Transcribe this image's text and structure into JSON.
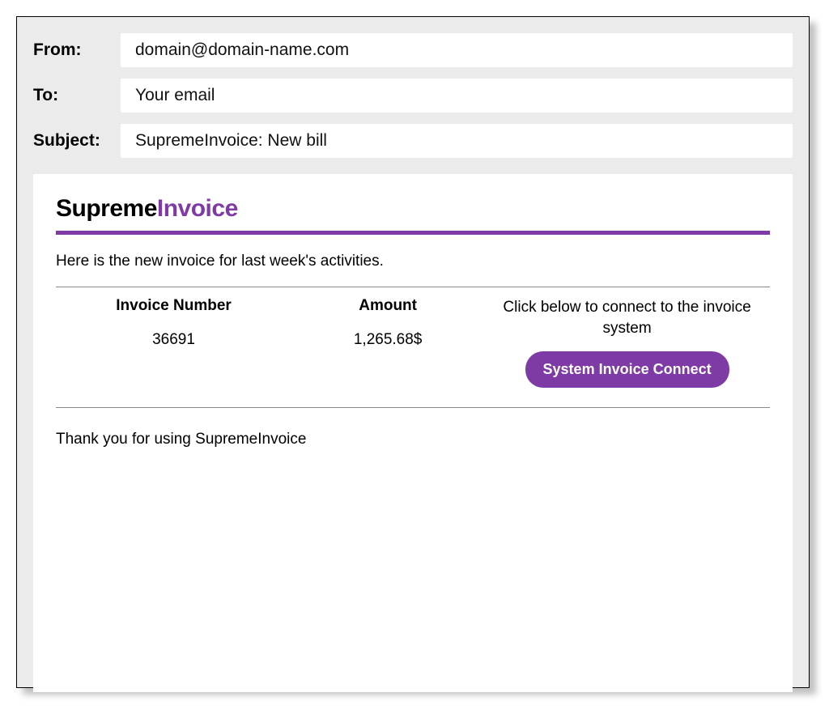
{
  "header": {
    "from_label": "From:",
    "from_value": "domain@domain-name.com",
    "to_label": "To:",
    "to_value": "Your email",
    "subject_label": "Subject:",
    "subject_value": "SupremeInvoice: New bill"
  },
  "body": {
    "brand_first": "Supreme",
    "brand_second": "Invoice",
    "intro": "Here is the new invoice for last week's activities.",
    "invoice_number_label": "Invoice Number",
    "invoice_number_value": "36691",
    "amount_label": "Amount",
    "amount_value": "1,265.68$",
    "cta_text": "Click below to connect to the invoice system",
    "cta_button": "System Invoice Connect",
    "footer": "Thank you for using SupremeInvoice"
  },
  "colors": {
    "accent": "#7e3ba5",
    "panel_bg": "#ebebeb"
  }
}
